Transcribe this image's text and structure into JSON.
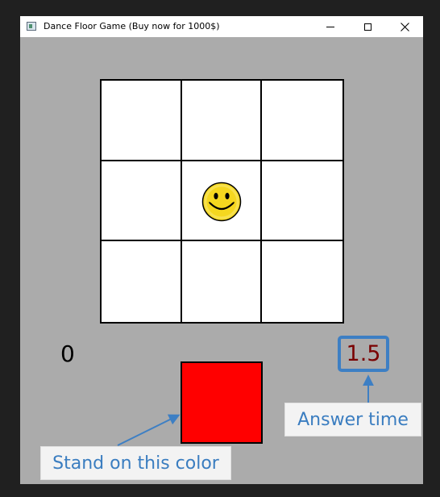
{
  "window": {
    "title": "Dance Floor Game (Buy now for 1000$)",
    "icon": "app-icon"
  },
  "titlebar_buttons": {
    "minimize": "minimize-icon",
    "maximize": "maximize-icon",
    "close": "close-icon"
  },
  "board": {
    "rows": 3,
    "cols": 3,
    "player_cell": "row 2, column 2",
    "player_icon": "smiley-face-icon"
  },
  "score": "0",
  "timer": "1.5",
  "target_color": "#ff0000",
  "annotations": {
    "answer_time": "Answer time",
    "stand_on_color": "Stand on this color"
  },
  "colors": {
    "background": "#ababab",
    "cell": "#ffffff",
    "accent": "#3d7fc4",
    "timer_text": "#7a0000"
  }
}
